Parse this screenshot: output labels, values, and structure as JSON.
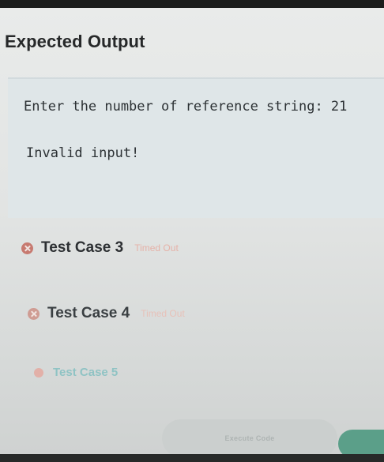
{
  "panel": {
    "title": "Expected Output"
  },
  "expected_output": {
    "lines": [
      "Enter the number of reference string: 21",
      "Invalid input!"
    ]
  },
  "test_cases": [
    {
      "label": "Test Case 3",
      "status": "Timed Out",
      "icon": "error-icon"
    },
    {
      "label": "Test Case 4",
      "status": "Timed Out",
      "icon": "error-icon"
    },
    {
      "label": "Test Case 5",
      "status": "",
      "icon": "error-icon"
    }
  ],
  "footer": {
    "execute_label": "Execute Code"
  },
  "colors": {
    "error": "#c77a70",
    "status_text": "#e5b2a8",
    "accent": "#5b9f89",
    "faded_label": "#8fc3c4"
  }
}
